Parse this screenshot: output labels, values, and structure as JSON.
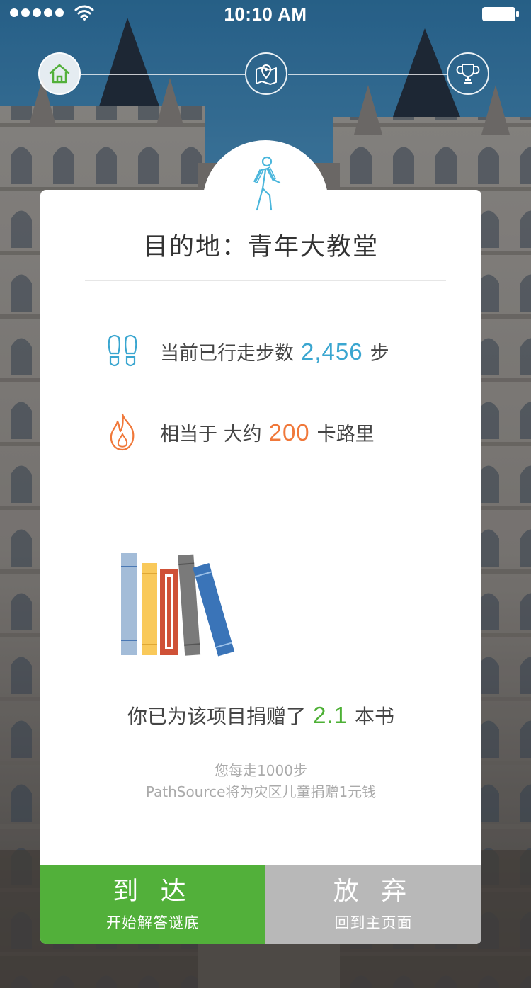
{
  "status_bar": {
    "time": "10:10 AM"
  },
  "progress": {
    "steps": [
      {
        "icon": "home-icon",
        "state": "active"
      },
      {
        "icon": "map-pin-icon",
        "state": "inactive"
      },
      {
        "icon": "trophy-icon",
        "state": "inactive"
      }
    ]
  },
  "card": {
    "icon": "walking-person-icon",
    "destination": "目的地：青年大教堂",
    "steps_stat": {
      "icon": "footprints-icon",
      "prefix": "当前已行走步数",
      "value": "2,456",
      "suffix": "步"
    },
    "calorie_stat": {
      "icon": "flame-icon",
      "prefix": "相当于 大约",
      "value": "200",
      "suffix": "卡路里"
    },
    "illustration": "books-icon",
    "donation": {
      "prefix": "你已为该项目捐赠了",
      "value": "2.1",
      "suffix": "本书"
    },
    "note_line1": "您每走1000步",
    "note_line2": "PathSource将为灾区儿童捐赠1元钱"
  },
  "actions": {
    "arrive": {
      "title": "到 达",
      "subtitle": "开始解答谜底"
    },
    "give_up": {
      "title": "放 弃",
      "subtitle": "回到主页面"
    }
  },
  "colors": {
    "accent_green": "#52b03a",
    "accent_blue": "#3aa6d0",
    "accent_orange": "#f0783a",
    "neutral_gray": "#b8b8b8"
  }
}
